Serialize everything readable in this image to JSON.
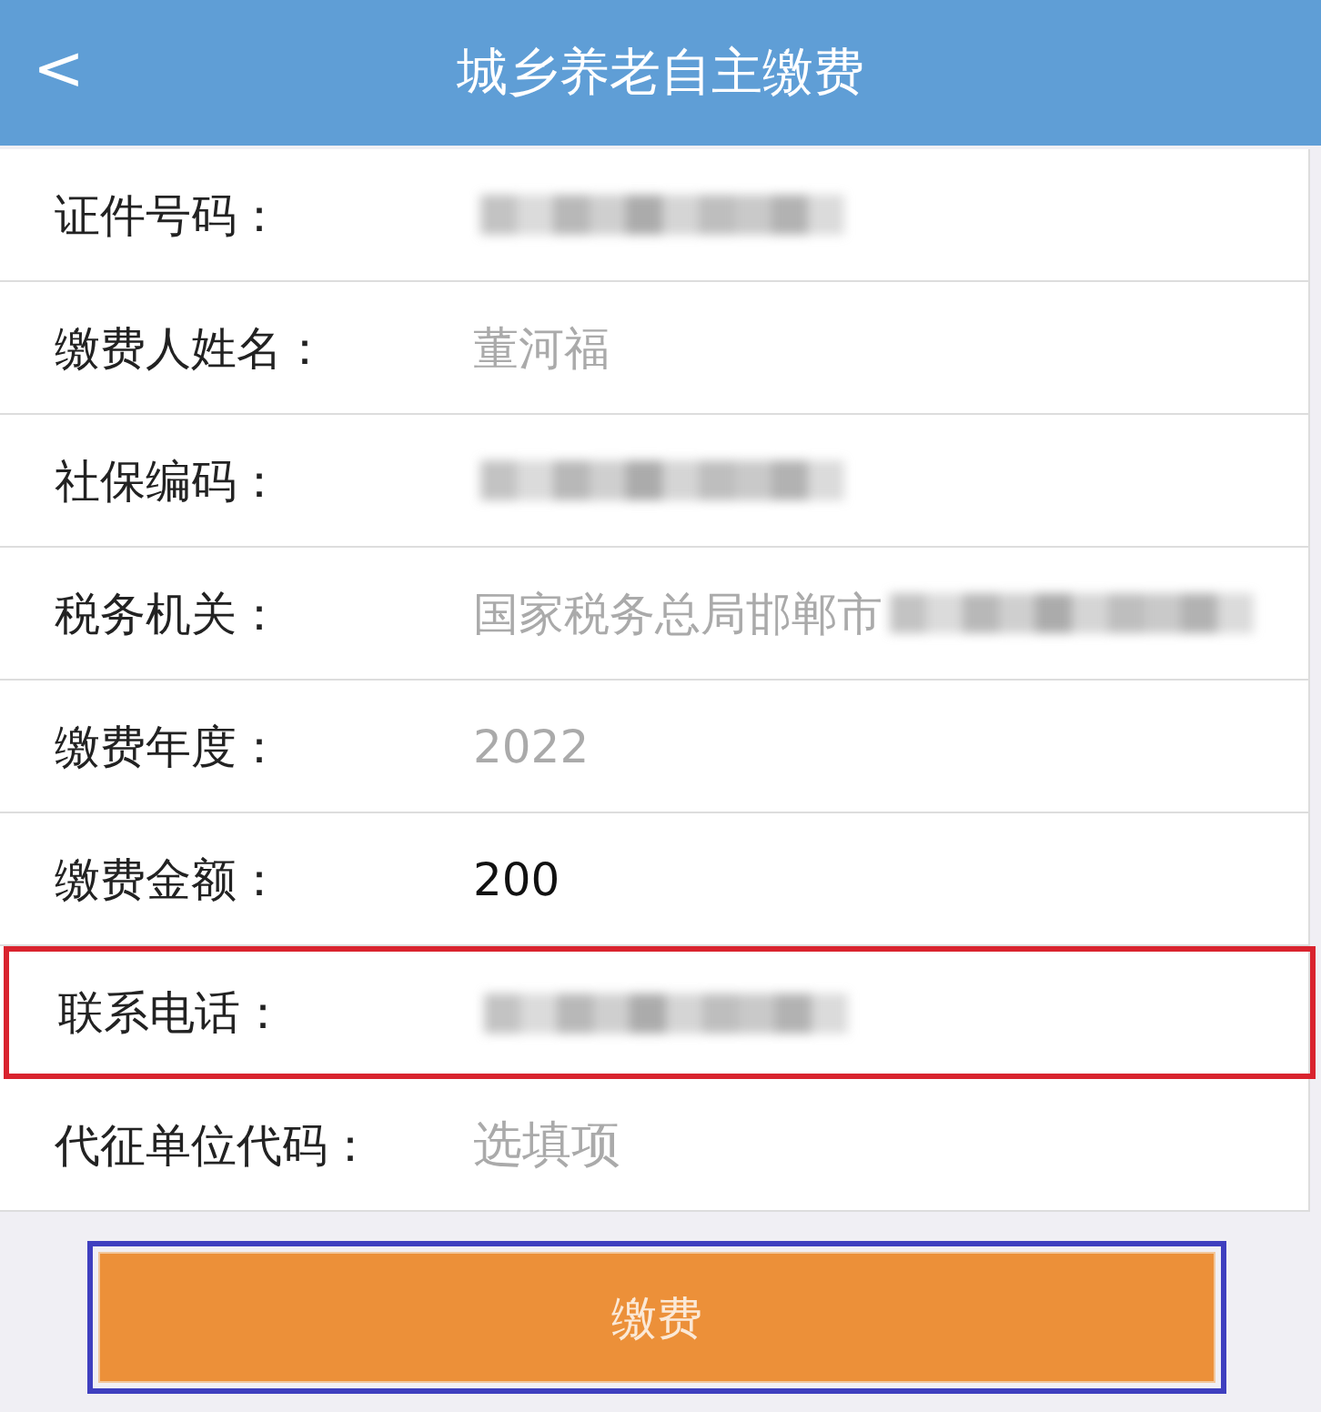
{
  "header": {
    "back": "<",
    "title": "城乡养老自主缴费"
  },
  "fields": [
    {
      "label": "证件号码：",
      "redacted": true,
      "highlighted": false
    },
    {
      "label": "缴费人姓名：",
      "value": "董河福",
      "readonly": true,
      "highlighted": false
    },
    {
      "label": "社保编码：",
      "redacted": true,
      "highlighted": false
    },
    {
      "label": "税务机关：",
      "value": "国家税务总局邯郸市",
      "readonly": true,
      "redacted": true,
      "highlighted": false
    },
    {
      "label": "缴费年度：",
      "value": "2022",
      "readonly": true,
      "highlighted": false
    },
    {
      "label": "缴费金额：",
      "value": "200",
      "readonly": false,
      "highlighted": false
    },
    {
      "label": "联系电话：",
      "redacted": true,
      "highlighted": true
    },
    {
      "label": "代征单位代码：",
      "placeholder": "选填项",
      "highlighted": false
    }
  ],
  "submit": {
    "label": "缴费",
    "highlighted": true
  }
}
